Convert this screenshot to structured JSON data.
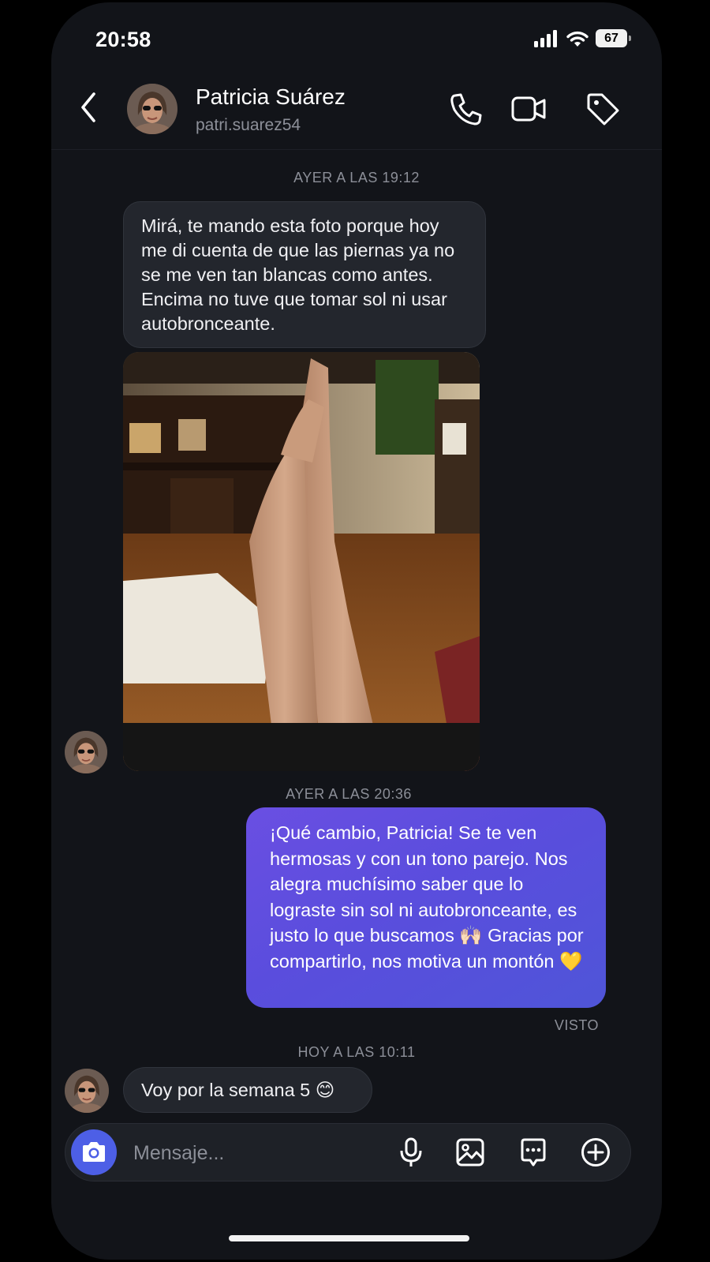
{
  "status_bar": {
    "time": "20:58",
    "battery": "67"
  },
  "header": {
    "contact_name": "Patricia Suárez",
    "contact_handle": "patri.suarez54",
    "icons": [
      "back-icon",
      "phone-icon",
      "video-icon",
      "tag-icon"
    ]
  },
  "messages": {
    "ts1": "AYER A LAS 19:12",
    "in1_text": "Mirá, te mando esta foto porque hoy me di cuenta de que las piernas ya no se me ven tan blancas como antes. Encima no tuve que tomar sol ni usar autobronceante.",
    "ts2": "AYER A LAS 20:36",
    "out1_text": "¡Qué cambio, Patricia! Se te ven hermosas y con un tono parejo. Nos alegra muchísimo saber que lo lograste sin sol ni autobronceante, es justo lo que buscamos 🙌🏻 Gracias por compartirlo, nos motiva un montón 💛",
    "seen": "VISTO",
    "ts3": "HOY A LAS 10:11",
    "in2_text": "Voy por la semana 5 😊"
  },
  "composer": {
    "placeholder": "Mensaje...",
    "icons": [
      "camera-icon",
      "microphone-icon",
      "gallery-icon",
      "sticker-icon",
      "add-icon"
    ]
  },
  "colors": {
    "background": "#121419",
    "incoming_bubble": "#23262d",
    "outgoing_bubble": "#5a4ddd",
    "camera_button": "#4d5fe6"
  }
}
